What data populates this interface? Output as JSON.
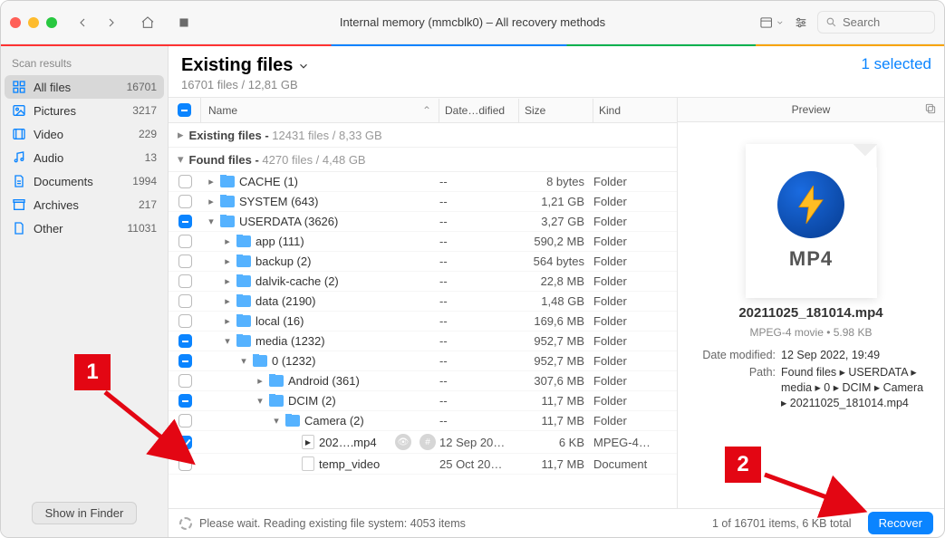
{
  "window_title": "Internal memory (mmcblk0) – All recovery methods",
  "search_placeholder": "Search",
  "sidebar": {
    "heading": "Scan results",
    "items": [
      {
        "label": "All files",
        "count": "16701",
        "active": true,
        "icon": "grid"
      },
      {
        "label": "Pictures",
        "count": "3217",
        "icon": "picture"
      },
      {
        "label": "Video",
        "count": "229",
        "icon": "video"
      },
      {
        "label": "Audio",
        "count": "13",
        "icon": "audio"
      },
      {
        "label": "Documents",
        "count": "1994",
        "icon": "doc"
      },
      {
        "label": "Archives",
        "count": "217",
        "icon": "archive"
      },
      {
        "label": "Other",
        "count": "11031",
        "icon": "blank"
      }
    ],
    "finder_btn": "Show in Finder"
  },
  "main": {
    "title": "Existing files",
    "subtitle": "16701 files / 12,81 GB",
    "selected": "1 selected"
  },
  "columns": {
    "name": "Name",
    "date": "Date…dified",
    "size": "Size",
    "kind": "Kind"
  },
  "groups": [
    {
      "label": "Existing files",
      "detail": "12431 files / 8,33 GB",
      "expanded": false
    },
    {
      "label": "Found files",
      "detail": "4270 files / 4,48 GB",
      "expanded": true
    }
  ],
  "rows": [
    {
      "indent": 0,
      "check": "off",
      "caret": ">",
      "name": "CACHE (1)",
      "date": "--",
      "size": "8 bytes",
      "kind": "Folder",
      "type": "folder"
    },
    {
      "indent": 0,
      "check": "off",
      "caret": ">",
      "name": "SYSTEM (643)",
      "date": "--",
      "size": "1,21 GB",
      "kind": "Folder",
      "type": "folder"
    },
    {
      "indent": 0,
      "check": "minus",
      "caret": "v",
      "name": "USERDATA (3626)",
      "date": "--",
      "size": "3,27 GB",
      "kind": "Folder",
      "type": "folder"
    },
    {
      "indent": 1,
      "check": "off",
      "caret": ">",
      "name": "app (111)",
      "date": "--",
      "size": "590,2 MB",
      "kind": "Folder",
      "type": "folder"
    },
    {
      "indent": 1,
      "check": "off",
      "caret": ">",
      "name": "backup (2)",
      "date": "--",
      "size": "564 bytes",
      "kind": "Folder",
      "type": "folder"
    },
    {
      "indent": 1,
      "check": "off",
      "caret": ">",
      "name": "dalvik-cache (2)",
      "date": "--",
      "size": "22,8 MB",
      "kind": "Folder",
      "type": "folder"
    },
    {
      "indent": 1,
      "check": "off",
      "caret": ">",
      "name": "data (2190)",
      "date": "--",
      "size": "1,48 GB",
      "kind": "Folder",
      "type": "folder"
    },
    {
      "indent": 1,
      "check": "off",
      "caret": ">",
      "name": "local (16)",
      "date": "--",
      "size": "169,6 MB",
      "kind": "Folder",
      "type": "folder"
    },
    {
      "indent": 1,
      "check": "minus",
      "caret": "v",
      "name": "media (1232)",
      "date": "--",
      "size": "952,7 MB",
      "kind": "Folder",
      "type": "folder"
    },
    {
      "indent": 2,
      "check": "minus",
      "caret": "v",
      "name": "0 (1232)",
      "date": "--",
      "size": "952,7 MB",
      "kind": "Folder",
      "type": "folder"
    },
    {
      "indent": 3,
      "check": "off",
      "caret": ">",
      "name": "Android (361)",
      "date": "--",
      "size": "307,6 MB",
      "kind": "Folder",
      "type": "folder"
    },
    {
      "indent": 3,
      "check": "minus",
      "caret": "v",
      "name": "DCIM (2)",
      "date": "--",
      "size": "11,7 MB",
      "kind": "Folder",
      "type": "folder"
    },
    {
      "indent": 4,
      "check": "off",
      "caret": "v",
      "name": "Camera (2)",
      "date": "--",
      "size": "11,7 MB",
      "kind": "Folder",
      "type": "folder"
    },
    {
      "indent": 5,
      "check": "on",
      "caret": "",
      "name": "202….mp4",
      "date": "12 Sep 20…",
      "size": "6 KB",
      "kind": "MPEG-4…",
      "type": "mp4",
      "actions": true
    },
    {
      "indent": 5,
      "check": "off",
      "caret": "",
      "name": "temp_video",
      "date": "25 Oct 20…",
      "size": "11,7 MB",
      "kind": "Document",
      "type": "file"
    }
  ],
  "preview": {
    "heading": "Preview",
    "thumb_label": "MP4",
    "filename": "20211025_181014.mp4",
    "meta": "MPEG-4 movie • 5.98 KB",
    "date_modified_k": "Date modified:",
    "date_modified_v": "12 Sep 2022, 19:49",
    "path_k": "Path:",
    "path_v": "Found files ▸ USERDATA ▸ media ▸ 0 ▸ DCIM ▸ Camera ▸ 20211025_181014.mp4"
  },
  "footer": {
    "status": "Please wait. Reading existing file system: 4053 items",
    "summary": "1 of 16701 items, 6 KB total",
    "recover": "Recover"
  },
  "annotations": {
    "b1": "1",
    "b2": "2"
  }
}
